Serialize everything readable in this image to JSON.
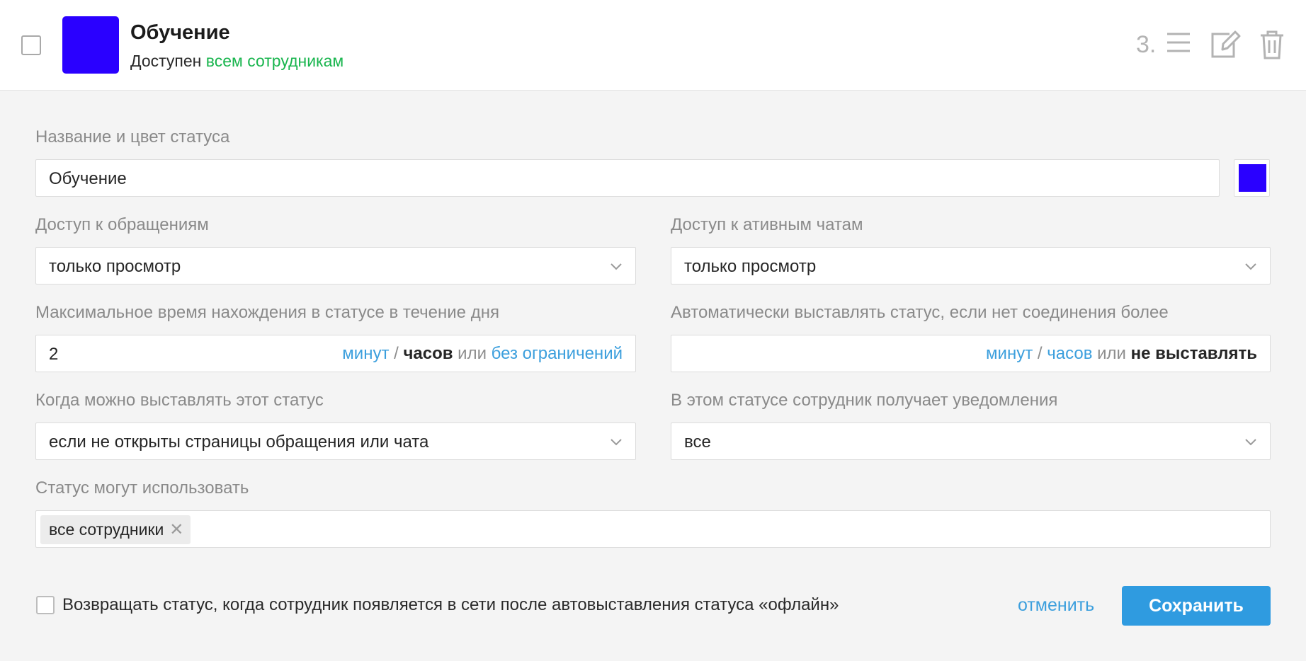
{
  "status": {
    "title": "Обучение",
    "color": "#2a00ff",
    "subtitle_prefix": "Доступен",
    "subtitle_link": "всем сотрудникам",
    "order": "3."
  },
  "form": {
    "name_label": "Название и цвет статуса",
    "name_value": "Обучение",
    "requests_access_label": "Доступ к обращениям",
    "requests_access_value": "только просмотр",
    "chats_access_label": "Доступ к ативным чатам",
    "chats_access_value": "только просмотр",
    "max_time_label": "Максимальное время нахождения в статусе в течение дня",
    "max_time_value": "2",
    "max_time_units": {
      "minutes": "минут",
      "sep": " / ",
      "hours": "часов",
      "or": " или ",
      "option": "без ограничений"
    },
    "auto_label": "Автоматически выставлять статус, если нет соединения более",
    "auto_value": "",
    "auto_units": {
      "minutes": "минут",
      "sep": " / ",
      "hours": "часов",
      "or": " или ",
      "option": "не выставлять"
    },
    "when_label": "Когда можно выставлять этот статус",
    "when_value": "если не открыты страницы обращения или чата",
    "notify_label": "В этом статусе сотрудник получает уведомления",
    "notify_value": "все",
    "users_label": "Статус могут использовать",
    "users_tags": [
      "все сотрудники"
    ],
    "return_checkbox_label": "Возвращать статус, когда сотрудник появляется в сети после автовыставления статуса «офлайн»",
    "cancel_label": "отменить",
    "save_label": "Сохранить"
  }
}
